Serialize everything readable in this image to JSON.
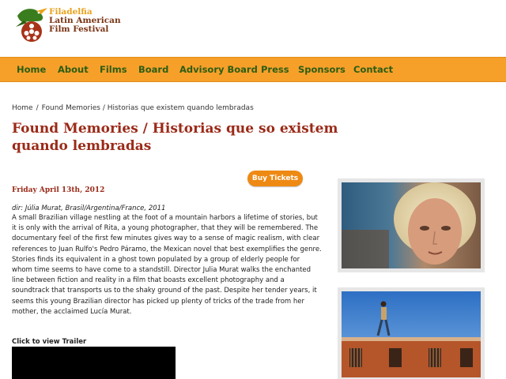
{
  "logo": {
    "line1": "Filadelfia",
    "line2": "Latin American",
    "line3": "Film Festival"
  },
  "nav": {
    "items": [
      "Home",
      "About",
      "Films",
      "Board",
      "Advisory Board",
      "Press",
      "Sponsors",
      "Contact"
    ]
  },
  "breadcrumb": {
    "home": "Home",
    "separator": "/",
    "current": "Found Memories / Historias que existem quando lembradas"
  },
  "film": {
    "title": "Found Memories / Historias que so existem quando lembradas",
    "buy_label": "Buy Tickets",
    "date": "Friday April 13th, 2012",
    "director": "dir: Júlia Murat, Brasil/Argentina/France, 2011",
    "description": "A small Brazilian village nestling at the foot of a mountain harbors a lifetime of stories, but it is only with the arrival of Rita, a young photographer, that they will be remembered. The documentary feel of the first few minutes gives way to a sense of magic realism, with clear references to Juan Rulfo's Pedro Páramo, the Mexican novel that best exemplifies the genre. Stories finds its equivalent in a ghost town populated by a group of elderly people for whom time seems to have come to a standstill. Director Julia Murat walks the enchanted line between fiction and reality in a film that boasts excellent photography and a soundtrack that transports us to the shaky ground of the past. Despite her tender years, it seems this young Brazilian director has picked up plenty of tricks of the trade from her mother, the acclaimed Lucía Murat.",
    "trailer_label": "Click to view Trailer"
  },
  "colors": {
    "nav_bg": "#f6a02a",
    "nav_text": "#2c5d14",
    "title": "#9b2a18",
    "button": "#ee8a14"
  }
}
